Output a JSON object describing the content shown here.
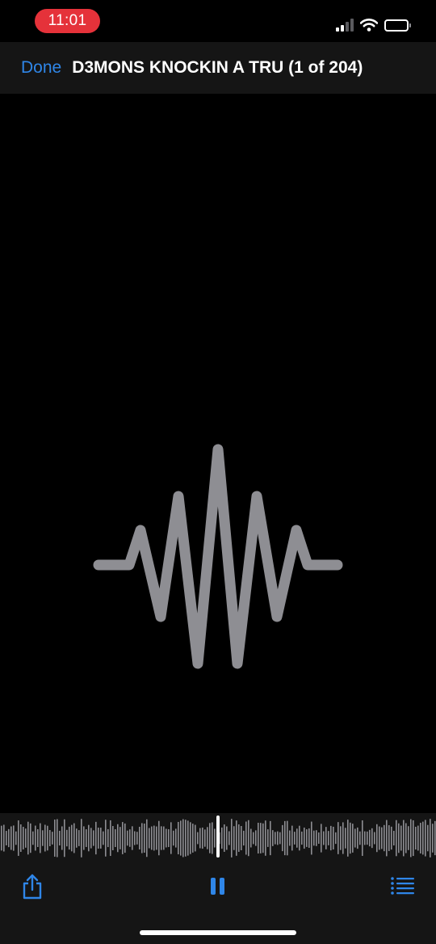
{
  "status_bar": {
    "time": "11:01",
    "recording_indicator_color": "#e5323a",
    "icons": [
      "cellular-signal-icon",
      "wifi-icon",
      "battery-icon"
    ],
    "signal_bars_active": 2,
    "signal_bars_total": 4
  },
  "header": {
    "done_label": "Done",
    "title": "D3MONS KNOCKIN A TRU (1 of 204)"
  },
  "viewer": {
    "placeholder_icon": "audio-waveform-icon",
    "icon_color": "#8e8e93"
  },
  "scrubber": {
    "progress": 0.5
  },
  "toolbar": {
    "share_icon": "share-icon",
    "pause_icon": "pause-icon",
    "list_icon": "list-icon",
    "accent_color": "#2f86e8"
  },
  "colors": {
    "background": "#000000",
    "bars": "#151515",
    "accent": "#2f86e8",
    "waveform": "#8e8e93"
  }
}
